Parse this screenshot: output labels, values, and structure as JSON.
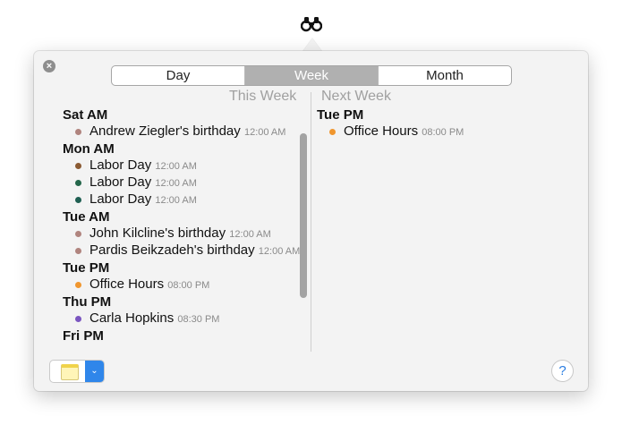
{
  "menubar": {
    "icon": "binoculars-icon"
  },
  "popover": {
    "close_icon": "close-icon",
    "view_tabs": [
      {
        "label": "Day"
      },
      {
        "label": "Week"
      },
      {
        "label": "Month"
      }
    ],
    "selected_tab": "Week",
    "this_week": {
      "header": "This Week",
      "days": [
        {
          "day": "Sat AM",
          "events": [
            {
              "title": "Andrew Ziegler's birthday",
              "time": "12:00 AM",
              "color": "#b0847e"
            }
          ]
        },
        {
          "day": "Mon AM",
          "events": [
            {
              "title": "Labor Day",
              "time": "12:00 AM",
              "color": "#8a5a32"
            },
            {
              "title": "Labor Day",
              "time": "12:00 AM",
              "color": "#24664a"
            },
            {
              "title": "Labor Day",
              "time": "12:00 AM",
              "color": "#1f5f52"
            }
          ]
        },
        {
          "day": "Tue AM",
          "events": [
            {
              "title": "John Kilcline's birthday",
              "time": "12:00 AM",
              "color": "#b0847e"
            },
            {
              "title": "Pardis Beikzadeh's birthday",
              "time": "12:00 AM",
              "color": "#b0847e"
            }
          ]
        },
        {
          "day": "Tue PM",
          "events": [
            {
              "title": "Office Hours",
              "time": "08:00 PM",
              "color": "#f0962e"
            }
          ]
        },
        {
          "day": "Thu PM",
          "events": [
            {
              "title": "Carla Hopkins",
              "time": "08:30 PM",
              "color": "#7a55c0"
            }
          ]
        },
        {
          "day": "Fri PM",
          "events": []
        }
      ]
    },
    "next_week": {
      "header": "Next Week",
      "days": [
        {
          "day": "Tue PM",
          "events": [
            {
              "title": "Office Hours",
              "time": "08:00 PM",
              "color": "#f0962e"
            }
          ]
        }
      ]
    },
    "bottom": {
      "app_icon": "notes-icon",
      "dropdown_icon": "chevron-down-icon",
      "help_label": "?"
    }
  }
}
